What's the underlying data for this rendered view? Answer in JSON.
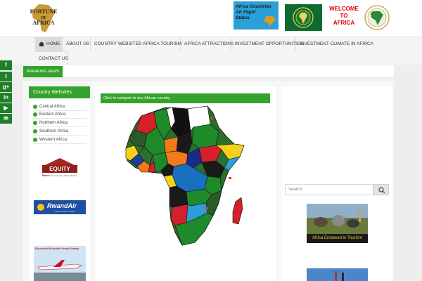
{
  "header": {
    "logo_line1": "FORTUNE",
    "logo_line2": "OF",
    "logo_line3": "AFRICA",
    "banner_flight_line1": "Africa Countries",
    "banner_flight_line2": "Air Flight",
    "banner_flight_line3": "Status",
    "welcome_line1": "WELCOME",
    "welcome_line2": "TO",
    "welcome_line3": "AFRICA"
  },
  "nav": {
    "items": [
      "HOME",
      "ABOUT US",
      "COUNTRY WEBSITES",
      "AFRICA TOURISM",
      "AFRICA ATTRACTIONS",
      "INVESTMENT OPPORTUNITIES",
      "INVESTMENT CLIMATE IN AFRICA",
      "CONTACT US"
    ]
  },
  "breaking": {
    "label": "BREAKING NEWS"
  },
  "sidebar_left": {
    "title": "Country Websites",
    "regions": [
      "Central Africa",
      "Eastern Africa",
      "Northern Africa",
      "Southern Africa",
      "Western Africa"
    ],
    "equity": {
      "name": "EQUITY",
      "sub": "Bank",
      "tagline": "Your Listening, Caring Partner"
    },
    "rwandair": {
      "name": "RwandAir",
      "tagline": "Fly the Heart of Africa"
    },
    "kenya_ad": "Fly around Africa with Kenya Airways"
  },
  "main": {
    "map_title": "Click to navigate to any African country"
  },
  "sidebar_right": {
    "search_placeholder": "Search",
    "tourism_caption": "Africa Endowed in Tourism"
  },
  "colors": {
    "accent": "#35a32b",
    "flight_banner": "#2a9fd8",
    "au_green": "#0e6b2f",
    "welcome_red": "#e00000"
  },
  "icons": [
    "home-icon",
    "facebook-icon",
    "twitter-icon",
    "google-plus-icon",
    "linkedin-icon",
    "youtube-icon",
    "email-icon",
    "search-icon"
  ]
}
